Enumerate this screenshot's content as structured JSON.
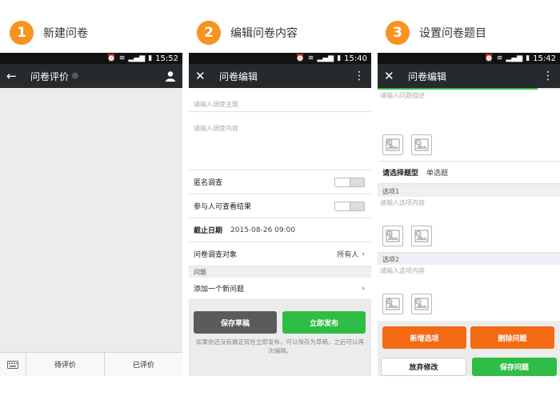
{
  "steps": [
    {
      "number": "1",
      "title": "新建问卷"
    },
    {
      "number": "2",
      "title": "编辑问卷内容"
    },
    {
      "number": "3",
      "title": "设置问卷题目"
    }
  ],
  "screen1": {
    "time": "15:52",
    "title": "问卷评价",
    "tabs": [
      "待评价",
      "已评价"
    ]
  },
  "screen2": {
    "time": "15:40",
    "title": "问卷编辑",
    "subject_placeholder": "请输入调查主题",
    "content_placeholder": "请输入调查内容",
    "anonymous_label": "匿名调查",
    "view_results_label": "参与人可查看结果",
    "deadline_label": "截止日期",
    "deadline_value": "2015-08-26 09:00",
    "target_label": "问卷调查对象",
    "target_value": "所有人",
    "question_section": "问题",
    "add_question_label": "添加一个新问题",
    "save_draft_label": "保存草稿",
    "publish_label": "立即发布",
    "hint": "如果你还没有确定现在立即发布，可以保存为草稿，之后可以再次编辑。"
  },
  "screen3": {
    "time": "15:42",
    "title": "问卷编辑",
    "desc_placeholder": "请输入问题描述",
    "type_label": "请选择题型",
    "type_value": "单选题",
    "option1_label": "选项1",
    "option1_placeholder": "请输入选项内容",
    "option2_label": "选项2",
    "option2_placeholder": "请输入选项内容",
    "add_option_label": "新增选项",
    "delete_question_label": "删除问题",
    "discard_label": "放弃修改",
    "save_question_label": "保存问题"
  },
  "colors": {
    "accent_orange": "#f7931e",
    "orange_button": "#f46a13",
    "green_button": "#2fbd45",
    "gray_button": "#5b5b5b",
    "titlebar": "#262a2d"
  }
}
